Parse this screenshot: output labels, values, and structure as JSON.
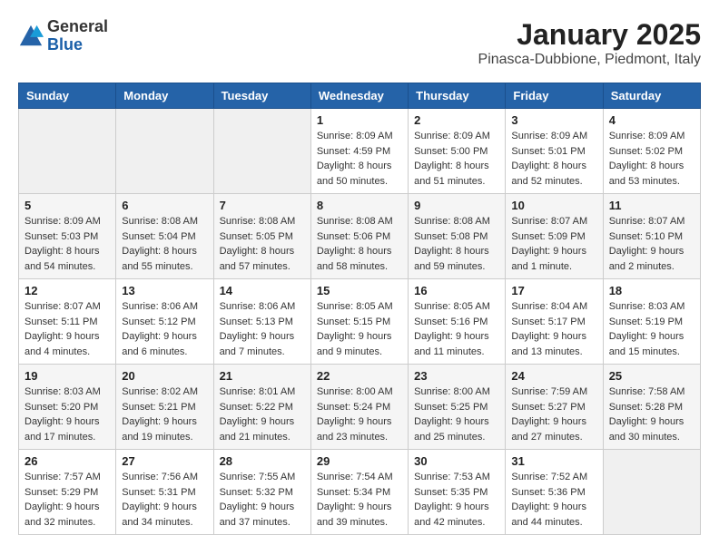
{
  "logo": {
    "general": "General",
    "blue": "Blue"
  },
  "title": "January 2025",
  "subtitle": "Pinasca-Dubbione, Piedmont, Italy",
  "weekdays": [
    "Sunday",
    "Monday",
    "Tuesday",
    "Wednesday",
    "Thursday",
    "Friday",
    "Saturday"
  ],
  "weeks": [
    [
      {
        "day": "",
        "info": ""
      },
      {
        "day": "",
        "info": ""
      },
      {
        "day": "",
        "info": ""
      },
      {
        "day": "1",
        "info": "Sunrise: 8:09 AM\nSunset: 4:59 PM\nDaylight: 8 hours\nand 50 minutes."
      },
      {
        "day": "2",
        "info": "Sunrise: 8:09 AM\nSunset: 5:00 PM\nDaylight: 8 hours\nand 51 minutes."
      },
      {
        "day": "3",
        "info": "Sunrise: 8:09 AM\nSunset: 5:01 PM\nDaylight: 8 hours\nand 52 minutes."
      },
      {
        "day": "4",
        "info": "Sunrise: 8:09 AM\nSunset: 5:02 PM\nDaylight: 8 hours\nand 53 minutes."
      }
    ],
    [
      {
        "day": "5",
        "info": "Sunrise: 8:09 AM\nSunset: 5:03 PM\nDaylight: 8 hours\nand 54 minutes."
      },
      {
        "day": "6",
        "info": "Sunrise: 8:08 AM\nSunset: 5:04 PM\nDaylight: 8 hours\nand 55 minutes."
      },
      {
        "day": "7",
        "info": "Sunrise: 8:08 AM\nSunset: 5:05 PM\nDaylight: 8 hours\nand 57 minutes."
      },
      {
        "day": "8",
        "info": "Sunrise: 8:08 AM\nSunset: 5:06 PM\nDaylight: 8 hours\nand 58 minutes."
      },
      {
        "day": "9",
        "info": "Sunrise: 8:08 AM\nSunset: 5:08 PM\nDaylight: 8 hours\nand 59 minutes."
      },
      {
        "day": "10",
        "info": "Sunrise: 8:07 AM\nSunset: 5:09 PM\nDaylight: 9 hours\nand 1 minute."
      },
      {
        "day": "11",
        "info": "Sunrise: 8:07 AM\nSunset: 5:10 PM\nDaylight: 9 hours\nand 2 minutes."
      }
    ],
    [
      {
        "day": "12",
        "info": "Sunrise: 8:07 AM\nSunset: 5:11 PM\nDaylight: 9 hours\nand 4 minutes."
      },
      {
        "day": "13",
        "info": "Sunrise: 8:06 AM\nSunset: 5:12 PM\nDaylight: 9 hours\nand 6 minutes."
      },
      {
        "day": "14",
        "info": "Sunrise: 8:06 AM\nSunset: 5:13 PM\nDaylight: 9 hours\nand 7 minutes."
      },
      {
        "day": "15",
        "info": "Sunrise: 8:05 AM\nSunset: 5:15 PM\nDaylight: 9 hours\nand 9 minutes."
      },
      {
        "day": "16",
        "info": "Sunrise: 8:05 AM\nSunset: 5:16 PM\nDaylight: 9 hours\nand 11 minutes."
      },
      {
        "day": "17",
        "info": "Sunrise: 8:04 AM\nSunset: 5:17 PM\nDaylight: 9 hours\nand 13 minutes."
      },
      {
        "day": "18",
        "info": "Sunrise: 8:03 AM\nSunset: 5:19 PM\nDaylight: 9 hours\nand 15 minutes."
      }
    ],
    [
      {
        "day": "19",
        "info": "Sunrise: 8:03 AM\nSunset: 5:20 PM\nDaylight: 9 hours\nand 17 minutes."
      },
      {
        "day": "20",
        "info": "Sunrise: 8:02 AM\nSunset: 5:21 PM\nDaylight: 9 hours\nand 19 minutes."
      },
      {
        "day": "21",
        "info": "Sunrise: 8:01 AM\nSunset: 5:22 PM\nDaylight: 9 hours\nand 21 minutes."
      },
      {
        "day": "22",
        "info": "Sunrise: 8:00 AM\nSunset: 5:24 PM\nDaylight: 9 hours\nand 23 minutes."
      },
      {
        "day": "23",
        "info": "Sunrise: 8:00 AM\nSunset: 5:25 PM\nDaylight: 9 hours\nand 25 minutes."
      },
      {
        "day": "24",
        "info": "Sunrise: 7:59 AM\nSunset: 5:27 PM\nDaylight: 9 hours\nand 27 minutes."
      },
      {
        "day": "25",
        "info": "Sunrise: 7:58 AM\nSunset: 5:28 PM\nDaylight: 9 hours\nand 30 minutes."
      }
    ],
    [
      {
        "day": "26",
        "info": "Sunrise: 7:57 AM\nSunset: 5:29 PM\nDaylight: 9 hours\nand 32 minutes."
      },
      {
        "day": "27",
        "info": "Sunrise: 7:56 AM\nSunset: 5:31 PM\nDaylight: 9 hours\nand 34 minutes."
      },
      {
        "day": "28",
        "info": "Sunrise: 7:55 AM\nSunset: 5:32 PM\nDaylight: 9 hours\nand 37 minutes."
      },
      {
        "day": "29",
        "info": "Sunrise: 7:54 AM\nSunset: 5:34 PM\nDaylight: 9 hours\nand 39 minutes."
      },
      {
        "day": "30",
        "info": "Sunrise: 7:53 AM\nSunset: 5:35 PM\nDaylight: 9 hours\nand 42 minutes."
      },
      {
        "day": "31",
        "info": "Sunrise: 7:52 AM\nSunset: 5:36 PM\nDaylight: 9 hours\nand 44 minutes."
      },
      {
        "day": "",
        "info": ""
      }
    ]
  ]
}
